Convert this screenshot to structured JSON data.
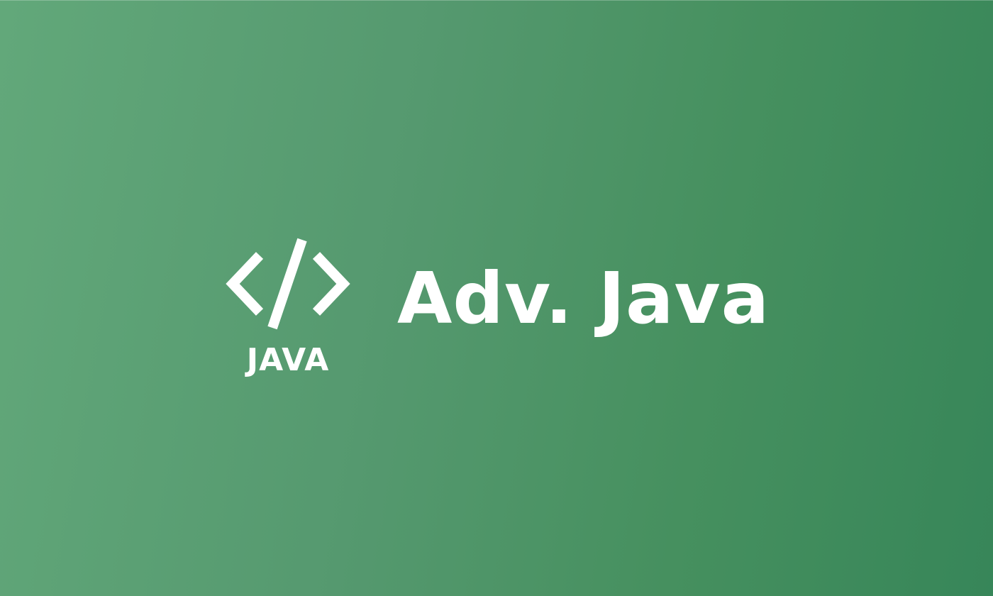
{
  "banner": {
    "title": "Adv. Java",
    "logo": {
      "icon": "code-brackets-icon",
      "label": "JAVA"
    }
  },
  "colors": {
    "background_start": "#62a87a",
    "background_end": "#378659",
    "foreground": "#ffffff"
  }
}
